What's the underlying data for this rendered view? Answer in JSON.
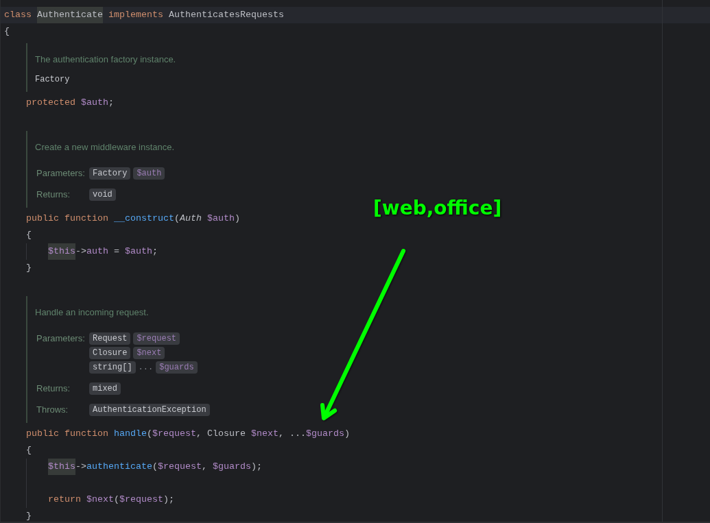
{
  "code": [
    {
      "kind": "code",
      "current": true,
      "tokens": [
        {
          "kind": "keyword",
          "t": "class "
        },
        {
          "kind": "match",
          "t": "Authenticate"
        },
        {
          "kind": "keyword",
          "t": " implements "
        },
        {
          "kind": "plain",
          "t": "AuthenticatesRequests"
        }
      ]
    },
    {
      "kind": "code",
      "current": false,
      "tokens": [
        {
          "kind": "plain",
          "t": "{"
        }
      ]
    },
    {
      "kind": "block",
      "children": [
        {
          "kind": "doc",
          "description": "The authentication factory instance.",
          "type": "Factory"
        },
        {
          "kind": "code",
          "current": false,
          "tokens": [
            {
              "kind": "keyword",
              "t": "protected "
            },
            {
              "kind": "variable",
              "t": "$auth"
            },
            {
              "kind": "plain",
              "t": ";"
            }
          ]
        },
        {
          "kind": "blank"
        },
        {
          "kind": "doc",
          "description": "Create a new middleware instance.",
          "sections": [
            {
              "label": "Parameters:",
              "rows": [
                [
                  {
                    "kind": "type",
                    "t": "Factory"
                  },
                  {
                    "kind": "variable",
                    "t": "$auth"
                  }
                ]
              ]
            },
            {
              "label": "Returns:",
              "rows": [
                [
                  {
                    "kind": "type",
                    "t": "void"
                  }
                ]
              ]
            }
          ]
        },
        {
          "kind": "code",
          "current": false,
          "tokens": [
            {
              "kind": "keyword",
              "t": "public function "
            },
            {
              "kind": "function",
              "t": "__construct"
            },
            {
              "kind": "plain",
              "t": "("
            },
            {
              "kind": "italic",
              "t": "Auth "
            },
            {
              "kind": "variable",
              "t": "$auth"
            },
            {
              "kind": "plain",
              "t": ")"
            }
          ]
        },
        {
          "kind": "code",
          "current": false,
          "tokens": [
            {
              "kind": "plain",
              "t": "{"
            }
          ]
        },
        {
          "kind": "block",
          "children": [
            {
              "kind": "code",
              "current": false,
              "tokens": [
                {
                  "kind": "match-variable",
                  "t": "$this"
                },
                {
                  "kind": "plain",
                  "t": "->"
                },
                {
                  "kind": "variable",
                  "t": "auth"
                },
                {
                  "kind": "plain",
                  "t": " = "
                },
                {
                  "kind": "variable",
                  "t": "$auth"
                },
                {
                  "kind": "plain",
                  "t": ";"
                }
              ]
            }
          ]
        },
        {
          "kind": "code",
          "current": false,
          "tokens": [
            {
              "kind": "plain",
              "t": "}"
            }
          ]
        },
        {
          "kind": "blank"
        },
        {
          "kind": "doc",
          "description": "Handle an incoming request.",
          "sections": [
            {
              "label": "Parameters:",
              "rows": [
                [
                  {
                    "kind": "type",
                    "t": "Request"
                  },
                  {
                    "kind": "variable",
                    "t": "$request"
                  }
                ],
                [
                  {
                    "kind": "type",
                    "t": "Closure"
                  },
                  {
                    "kind": "variable",
                    "t": "$next"
                  }
                ],
                [
                  {
                    "kind": "type",
                    "t": "string[]"
                  },
                  {
                    "kind": "ellipsis",
                    "t": "..."
                  },
                  {
                    "kind": "variable",
                    "t": "$guards"
                  }
                ]
              ]
            },
            {
              "label": "Returns:",
              "rows": [
                [
                  {
                    "kind": "type",
                    "t": "mixed"
                  }
                ]
              ]
            },
            {
              "label": "Throws:",
              "rows": [
                [
                  {
                    "kind": "type",
                    "t": "AuthenticationException"
                  }
                ]
              ]
            }
          ]
        },
        {
          "kind": "code",
          "current": false,
          "tokens": [
            {
              "kind": "keyword",
              "t": "public function "
            },
            {
              "kind": "function",
              "t": "handle"
            },
            {
              "kind": "plain",
              "t": "("
            },
            {
              "kind": "variable",
              "t": "$request"
            },
            {
              "kind": "plain",
              "t": ", Closure "
            },
            {
              "kind": "variable",
              "t": "$next"
            },
            {
              "kind": "plain",
              "t": ", ..."
            },
            {
              "kind": "variable",
              "t": "$guards"
            },
            {
              "kind": "plain",
              "t": ")"
            }
          ]
        },
        {
          "kind": "code",
          "current": false,
          "tokens": [
            {
              "kind": "plain",
              "t": "{"
            }
          ]
        },
        {
          "kind": "block",
          "children": [
            {
              "kind": "code",
              "current": false,
              "tokens": [
                {
                  "kind": "match-variable",
                  "t": "$this"
                },
                {
                  "kind": "plain",
                  "t": "->"
                },
                {
                  "kind": "function",
                  "t": "authenticate"
                },
                {
                  "kind": "plain",
                  "t": "("
                },
                {
                  "kind": "variable",
                  "t": "$request"
                },
                {
                  "kind": "plain",
                  "t": ", "
                },
                {
                  "kind": "variable",
                  "t": "$guards"
                },
                {
                  "kind": "plain",
                  "t": ");"
                }
              ]
            },
            {
              "kind": "blank"
            },
            {
              "kind": "code",
              "current": false,
              "tokens": [
                {
                  "kind": "keyword",
                  "t": "return "
                },
                {
                  "kind": "variable",
                  "t": "$next"
                },
                {
                  "kind": "plain",
                  "t": "("
                },
                {
                  "kind": "variable",
                  "t": "$request"
                },
                {
                  "kind": "plain",
                  "t": ");"
                }
              ]
            }
          ]
        },
        {
          "kind": "code",
          "current": false,
          "tokens": [
            {
              "kind": "plain",
              "t": "}"
            }
          ]
        }
      ]
    }
  ],
  "annotation": {
    "label": "[web,office]"
  }
}
